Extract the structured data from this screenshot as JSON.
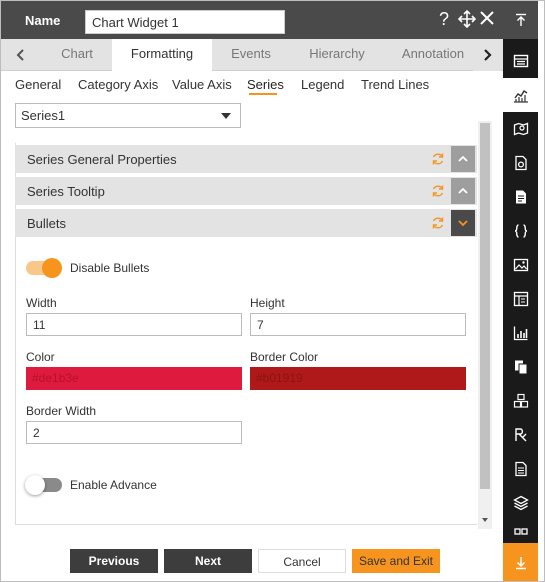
{
  "header": {
    "name_label": "Name",
    "name_value": "Chart Widget 1"
  },
  "main_tabs": [
    {
      "label": "Chart"
    },
    {
      "label": "Formatting"
    },
    {
      "label": "Events"
    },
    {
      "label": "Hierarchy"
    },
    {
      "label": "Annotation"
    }
  ],
  "sub_tabs": [
    {
      "label": "General"
    },
    {
      "label": "Category Axis"
    },
    {
      "label": "Value Axis"
    },
    {
      "label": "Series"
    },
    {
      "label": "Legend"
    },
    {
      "label": "Trend Lines"
    }
  ],
  "series_select": {
    "value": "Series1"
  },
  "sections": [
    {
      "title": "Series General Properties",
      "expanded": false
    },
    {
      "title": "Series Tooltip",
      "expanded": false
    },
    {
      "title": "Bullets",
      "expanded": true
    }
  ],
  "bullets": {
    "disable_bullets_label": "Disable Bullets",
    "disable_bullets_on": true,
    "width_label": "Width",
    "width_value": "11",
    "height_label": "Height",
    "height_value": "7",
    "color_label": "Color",
    "color_value": "#de1b3e",
    "border_color_label": "Border Color",
    "border_color_value": "#b01919",
    "border_width_label": "Border Width",
    "border_width_value": "2",
    "enable_advance_label": "Enable Advance",
    "enable_advance_on": false
  },
  "footer": {
    "previous": "Previous",
    "next": "Next",
    "cancel": "Cancel",
    "save_exit": "Save and Exit"
  },
  "colors": {
    "accent": "#f7941d",
    "header_bg": "#4a4a4a",
    "rail_bg": "#1a1a1a"
  },
  "rail_icons": [
    "collapse-top-icon",
    "table-icon",
    "line-chart-icon",
    "map-icon",
    "file-settings-icon",
    "document-icon",
    "code-braces-icon",
    "image-icon",
    "layout-icon",
    "bar-chart-icon",
    "copy-icon",
    "cubes-icon",
    "rx-icon",
    "report-icon",
    "layers-icon",
    "grid-icon",
    "download-icon"
  ]
}
